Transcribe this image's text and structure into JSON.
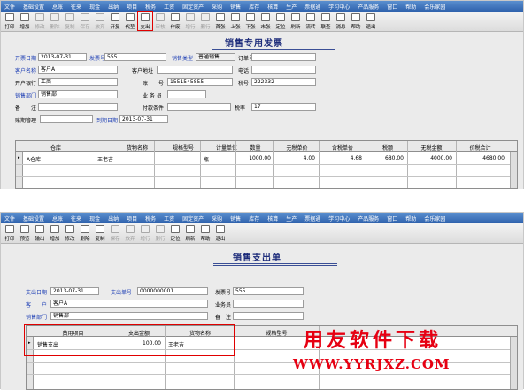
{
  "top": {
    "menu": [
      "文件",
      "基础设置",
      "总账",
      "往来",
      "现金",
      "出纳",
      "项目",
      "税务",
      "工资",
      "固定资产",
      "采购",
      "销售",
      "库存",
      "核算",
      "生产",
      "票据通",
      "学习中心",
      "产品服务",
      "窗口",
      "帮助",
      "会乐家园"
    ],
    "toolbar": [
      {
        "label": "打印",
        "icon": "printer-icon",
        "enabled": true
      },
      {
        "label": "增加",
        "icon": "new-doc-icon",
        "enabled": true
      },
      {
        "label": "修改",
        "icon": "edit-icon",
        "enabled": false
      },
      {
        "label": "删除",
        "icon": "delete-icon",
        "enabled": false
      },
      {
        "label": "复制",
        "icon": "copy-icon",
        "enabled": false
      },
      {
        "label": "保存",
        "icon": "save-icon",
        "enabled": false
      },
      {
        "label": "放弃",
        "icon": "undo-icon",
        "enabled": false
      },
      {
        "label": "开复",
        "icon": "reopen-icon",
        "enabled": true
      },
      {
        "label": "代垫",
        "icon": "advance-icon",
        "enabled": true
      },
      {
        "label": "支出",
        "icon": "expense-icon",
        "enabled": true,
        "highlighted": true
      },
      {
        "label": "审核",
        "icon": "approve-icon",
        "enabled": false
      },
      {
        "label": "作废",
        "icon": "void-icon",
        "enabled": true
      },
      {
        "label": "增行",
        "icon": "add-row-icon",
        "enabled": false
      },
      {
        "label": "删行",
        "icon": "delete-row-icon",
        "enabled": false
      },
      {
        "label": "首张",
        "icon": "first-icon",
        "enabled": true
      },
      {
        "label": "上张",
        "icon": "prev-icon",
        "enabled": true
      },
      {
        "label": "下张",
        "icon": "next-icon",
        "enabled": true
      },
      {
        "label": "末张",
        "icon": "last-icon",
        "enabled": true
      },
      {
        "label": "定位",
        "icon": "locate-icon",
        "enabled": true
      },
      {
        "label": "刷新",
        "icon": "refresh-icon",
        "enabled": true
      },
      {
        "label": "流转",
        "icon": "flow-icon",
        "enabled": true
      },
      {
        "label": "联查",
        "icon": "link-query-icon",
        "enabled": true
      },
      {
        "label": "消息",
        "icon": "message-icon",
        "enabled": true
      },
      {
        "label": "帮助",
        "icon": "help-icon",
        "enabled": true
      },
      {
        "label": "退出",
        "icon": "exit-icon",
        "enabled": true
      }
    ],
    "title": "销售专用发票",
    "labels": {
      "date": "开票日期",
      "invoice_no": "发票号",
      "sale_type": "销售类型",
      "order_no": "订单号",
      "customer": "客户名称",
      "address": "客户地址",
      "phone": "电话",
      "bank": "开户银行",
      "account": "账　　号",
      "tax_no": "税号",
      "dept": "销售部门",
      "salesman": "业 务 员",
      "remark": "备　　注",
      "payment": "付款条件",
      "tax_rate": "税率",
      "acct_mgmt": "账期管理",
      "due_date": "到期日期"
    },
    "values": {
      "date": "2013-07-31",
      "invoice_no": "555",
      "sale_type": "普通销售",
      "order_no": "",
      "customer": "客户A",
      "address": "",
      "phone": "",
      "bank": "工商",
      "account": "1551545855",
      "tax_no": "222332",
      "dept": "销售部",
      "salesman": "",
      "remark": "",
      "payment": "",
      "tax_rate": "17",
      "acct_mgmt": "",
      "due_date": "2013-07-31"
    },
    "columns": [
      "仓库",
      "货物名称",
      "规格型号",
      "计量单位",
      "数量",
      "无税单价",
      "含税单价",
      "税额",
      "无税金额",
      "价税合计"
    ],
    "rows": [
      [
        "A仓库",
        "王老吉",
        "",
        "瓶",
        "1000.00",
        "4.00",
        "4.68",
        "680.00",
        "4000.00",
        "4680.00"
      ]
    ]
  },
  "bottom": {
    "menu": [
      "文件",
      "基础设置",
      "总账",
      "往来",
      "现金",
      "出纳",
      "项目",
      "税务",
      "工资",
      "固定资产",
      "采购",
      "销售",
      "库存",
      "核算",
      "生产",
      "票据通",
      "学习中心",
      "产品服务",
      "窗口",
      "帮助",
      "会乐家园"
    ],
    "toolbar": [
      {
        "label": "打印",
        "icon": "printer-icon",
        "enabled": true
      },
      {
        "label": "预览",
        "icon": "preview-icon",
        "enabled": true
      },
      {
        "label": "输出",
        "icon": "export-icon",
        "enabled": true
      },
      {
        "label": "增加",
        "icon": "new-doc-icon",
        "enabled": true
      },
      {
        "label": "修改",
        "icon": "edit-icon",
        "enabled": true
      },
      {
        "label": "删除",
        "icon": "delete-icon",
        "enabled": true
      },
      {
        "label": "复制",
        "icon": "copy-icon",
        "enabled": true
      },
      {
        "label": "保存",
        "icon": "save-icon",
        "enabled": false
      },
      {
        "label": "放弃",
        "icon": "undo-icon",
        "enabled": false
      },
      {
        "label": "增行",
        "icon": "add-row-icon",
        "enabled": false
      },
      {
        "label": "删行",
        "icon": "delete-row-icon",
        "enabled": false
      },
      {
        "label": "定位",
        "icon": "locate-icon",
        "enabled": true
      },
      {
        "label": "刷新",
        "icon": "refresh-icon",
        "enabled": true
      },
      {
        "label": "帮助",
        "icon": "help-icon",
        "enabled": true
      },
      {
        "label": "退出",
        "icon": "exit-icon",
        "enabled": true
      }
    ],
    "title": "销售支出单",
    "labels": {
      "date": "支出日期",
      "expense_no": "支出单号",
      "invoice_no": "发票号",
      "customer": "客　　户",
      "salesman": "业务员",
      "dept": "销售部门",
      "remark": "备　注"
    },
    "values": {
      "date": "2013-07-31",
      "expense_no": "0000000001",
      "invoice_no": "555",
      "customer": "客户A",
      "salesman": "",
      "dept": "销售部",
      "remark": ""
    },
    "columns": [
      "费用项目",
      "支出金额",
      "货物名称",
      "规格型号"
    ],
    "rows": [
      [
        "销售支出",
        "100.00",
        "王老吉",
        ""
      ]
    ]
  },
  "watermark": {
    "line1": "用友软件下载",
    "line2": "WWW.YYRJXZ.COM"
  }
}
